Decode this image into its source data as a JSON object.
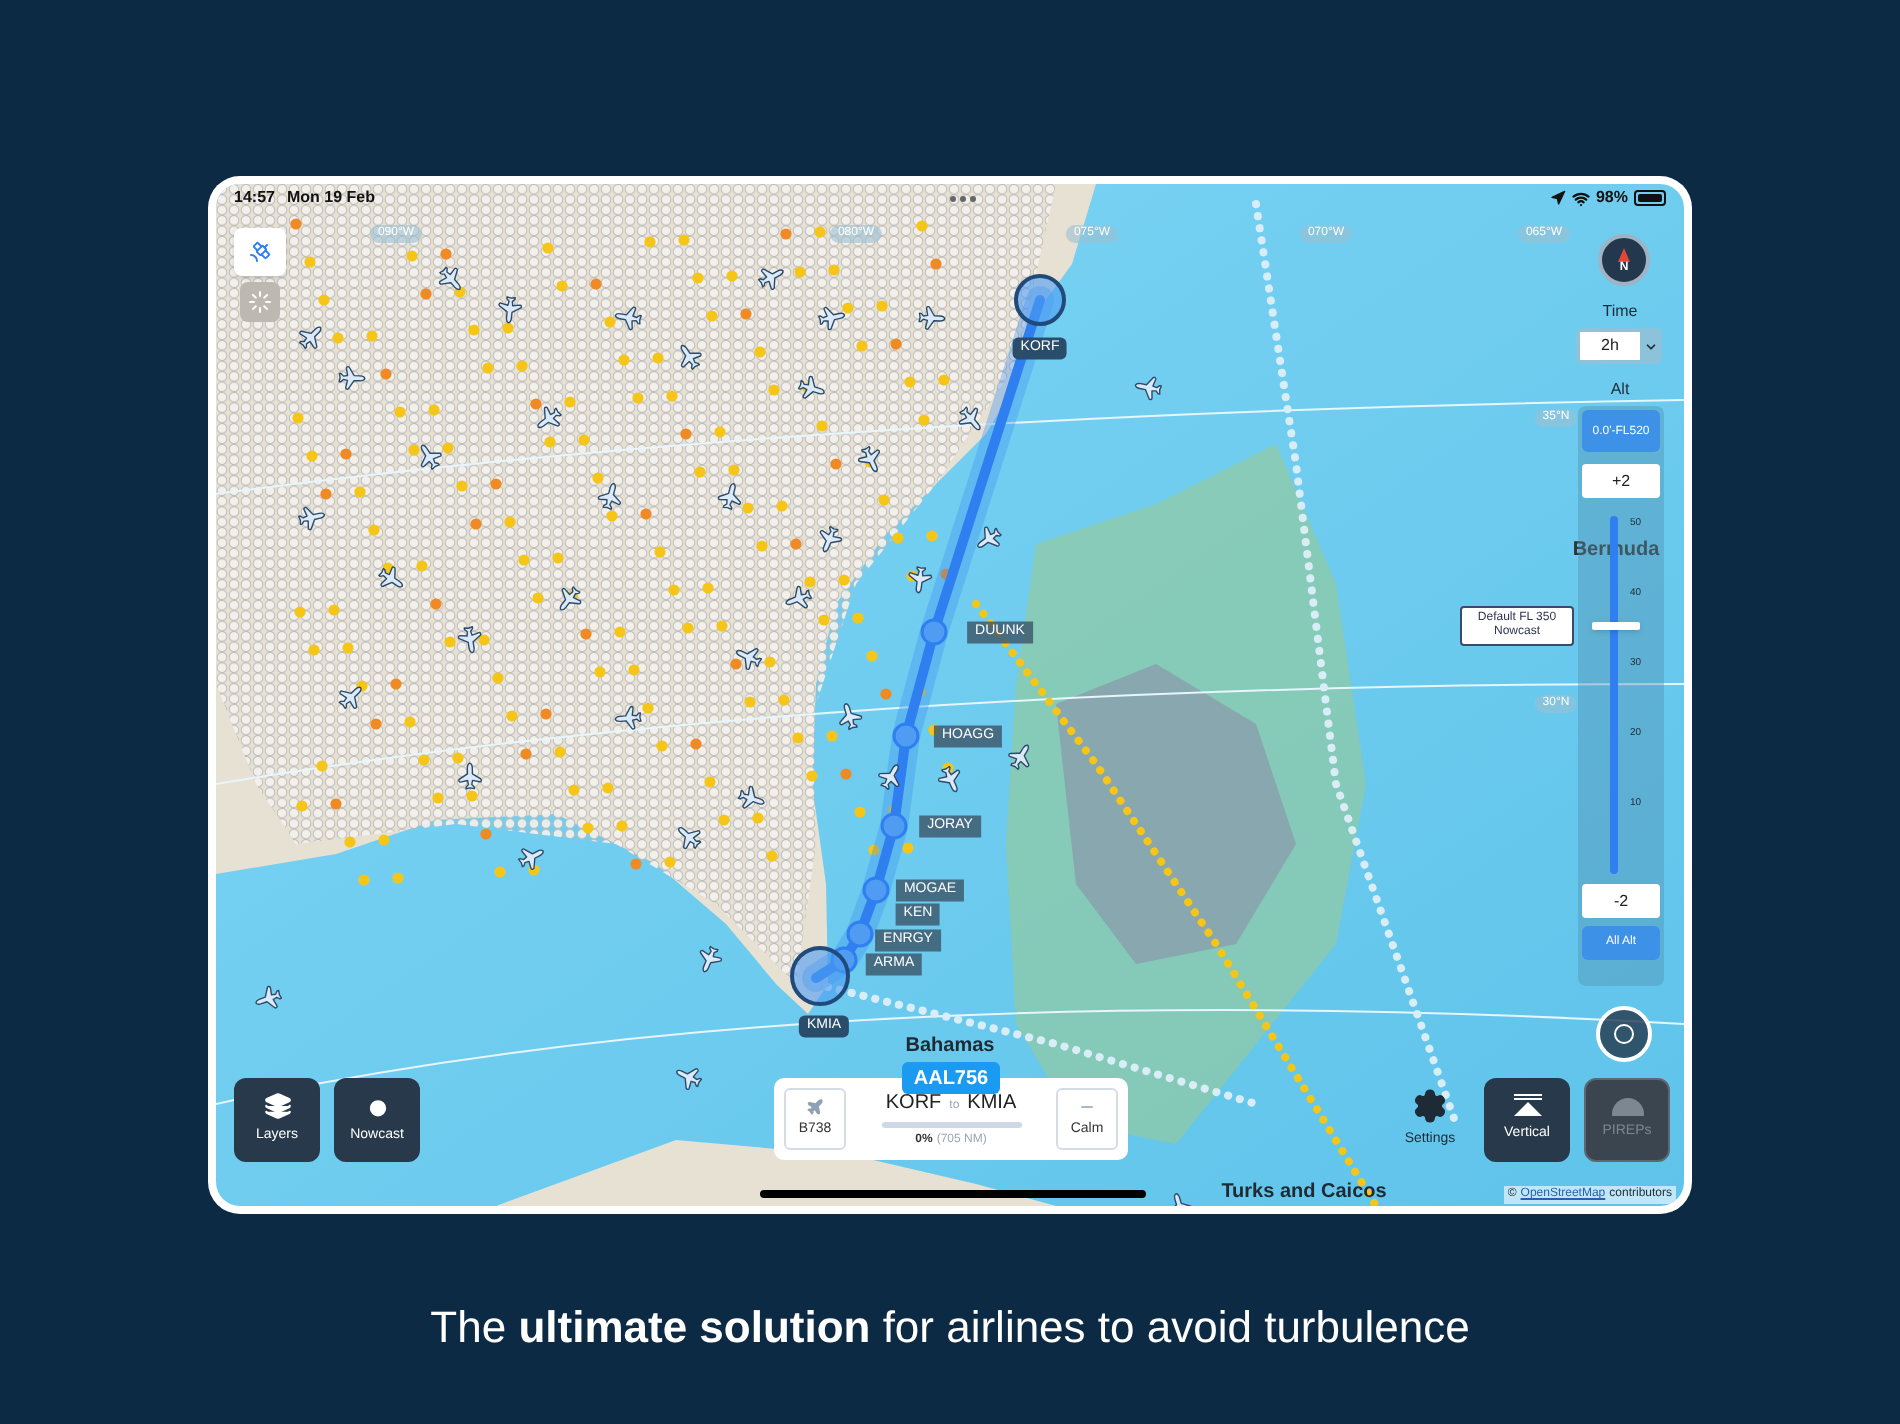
{
  "status_bar": {
    "time": "14:57",
    "date": "Mon 19 Feb",
    "battery": "98%"
  },
  "map": {
    "grid_labels": [
      "090°W",
      "080°W",
      "075°W",
      "070°W",
      "065°W",
      "35°N",
      "30°N"
    ],
    "waypoints": [
      {
        "name": "KORF",
        "kind": "airport"
      },
      {
        "name": "DUUNK",
        "kind": "fix"
      },
      {
        "name": "HOAGG",
        "kind": "fix"
      },
      {
        "name": "JORAY",
        "kind": "fix"
      },
      {
        "name": "MOGAE",
        "kind": "fix"
      },
      {
        "name": "KEN",
        "kind": "fix"
      },
      {
        "name": "ENRGY",
        "kind": "fix"
      },
      {
        "name": "ARMA",
        "kind": "fix"
      },
      {
        "name": "KMIA",
        "kind": "airport"
      }
    ],
    "place_labels": [
      "Bermuda",
      "Bahamas",
      "Turks and Caicos"
    ],
    "attribution": {
      "prefix": "©",
      "link": "OpenStreetMap",
      "suffix": "contributors"
    }
  },
  "map_tools": [
    {
      "selected": true
    },
    {
      "selected": false
    }
  ],
  "compass": {
    "label": "N"
  },
  "time": {
    "label": "Time",
    "value": "2h"
  },
  "altitude": {
    "label": "Alt",
    "range": "0.0'-FL520",
    "step_up": "+2",
    "ticks": [
      "50",
      "40",
      "30",
      "20",
      "10"
    ],
    "level": 0.69,
    "tooltip": "Default FL 350 Nowcast",
    "step_down": "-2",
    "all_button": "All Alt"
  },
  "left_buttons": [
    {
      "label": "Layers"
    },
    {
      "label": "Nowcast"
    }
  ],
  "flight_card": {
    "callsign": "AAL756",
    "aircraft": "B738",
    "origin": "KORF",
    "connector": "to",
    "destination": "KMIA",
    "level": 0,
    "progress": "0%",
    "distance": "(705 NM)",
    "turbulence": "Calm"
  },
  "right_buttons": [
    {
      "label": "Settings",
      "kind": "plain",
      "disabled": false
    },
    {
      "label": "Vertical",
      "kind": "tile",
      "disabled": false
    },
    {
      "label": "PIREPs",
      "kind": "tile",
      "disabled": true
    }
  ],
  "caption": "The **ultimate solution** for airlines to avoid turbulence"
}
